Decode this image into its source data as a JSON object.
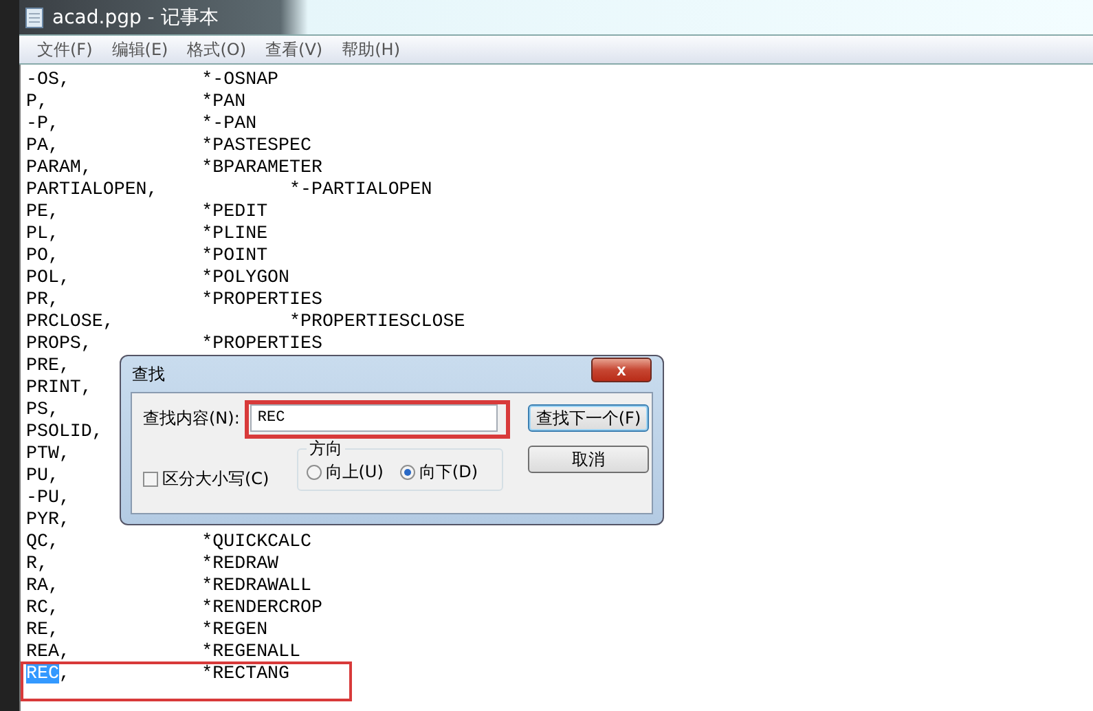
{
  "window": {
    "title": "acad.pgp - 记事本"
  },
  "menu": [
    "文件(F)",
    "编辑(E)",
    "格式(O)",
    "查看(V)",
    "帮助(H)"
  ],
  "lines": [
    {
      "text": "-OS,\t\t*-OSNAP"
    },
    {
      "text": "P,\t\t*PAN"
    },
    {
      "text": "-P,\t\t*-PAN"
    },
    {
      "text": "PA,\t\t*PASTESPEC"
    },
    {
      "text": "PARAM,\t\t*BPARAMETER"
    },
    {
      "text": "PARTIALOPEN,\t\t*-PARTIALOPEN"
    },
    {
      "text": "PE,\t\t*PEDIT"
    },
    {
      "text": "PL,\t\t*PLINE"
    },
    {
      "text": "PO,\t\t*POINT"
    },
    {
      "text": "POL,\t\t*POLYGON"
    },
    {
      "text": "PR,\t\t*PROPERTIES"
    },
    {
      "text": "PRCLOSE,\t\t*PROPERTIESCLOSE"
    },
    {
      "text": "PROPS,\t\t*PROPERTIES"
    },
    {
      "text": "PRE,"
    },
    {
      "text": "PRINT,"
    },
    {
      "text": "PS,"
    },
    {
      "text": "PSOLID,"
    },
    {
      "text": "PTW,"
    },
    {
      "text": "PU,"
    },
    {
      "text": "-PU,"
    },
    {
      "text": "PYR,"
    },
    {
      "text": "QC,\t\t*QUICKCALC"
    },
    {
      "text": "R,\t\t*REDRAW"
    },
    {
      "text": "RA,\t\t*REDRAWALL"
    },
    {
      "text": "RC,\t\t*RENDERCROP"
    },
    {
      "text": "RE,\t\t*REGEN"
    },
    {
      "text": "REA,\t\t*REGENALL"
    },
    {
      "selected_text": "REC",
      "text": ",\t\t*RECTANG"
    }
  ],
  "find_dialog": {
    "title": "查找",
    "close": "x",
    "find_label": "查找内容(N):",
    "find_value": "REC",
    "find_next": "查找下一个(F)",
    "cancel": "取消",
    "match_case": {
      "label": "区分大小写(C)",
      "checked": false
    },
    "direction": {
      "label": "方向",
      "options": [
        {
          "label": "向上(U)",
          "selected": false
        },
        {
          "label": "向下(D)",
          "selected": true
        }
      ]
    }
  }
}
